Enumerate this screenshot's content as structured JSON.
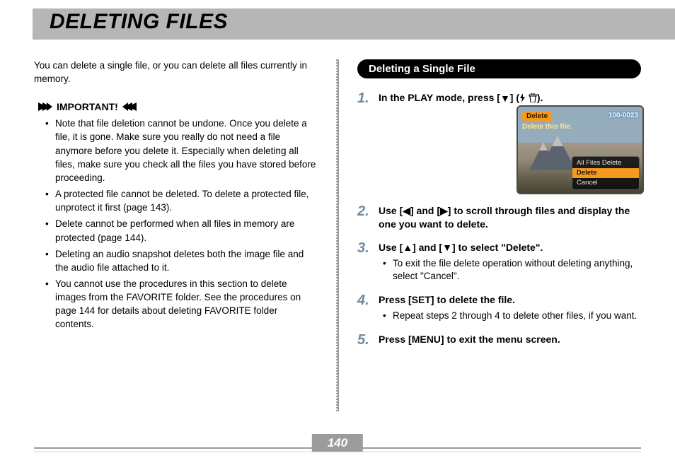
{
  "title": "DELETING FILES",
  "intro": "You can delete a single file, or you can delete all files currently in memory.",
  "important": {
    "heading": "IMPORTANT!",
    "items": [
      "Note that file deletion cannot be undone. Once you delete a file, it is gone. Make sure you really do not need a file anymore before you delete it. Especially when deleting all files, make sure you check all the files you have stored before proceeding.",
      "A protected file cannot be deleted. To delete a protected file, unprotect it first (page 143).",
      "Delete cannot be performed when all files in memory are protected (page 144).",
      "Deleting an audio snapshot deletes both the image file and the audio file attached to it.",
      "You cannot use the procedures in this section to delete images from the FAVORITE folder. See the procedures on page 144 for details about deleting FAVORITE folder contents."
    ]
  },
  "section": {
    "heading": "Deleting a Single File",
    "steps": [
      {
        "n": "1.",
        "body": "In the PLAY mode, press [▼] ({flash} {trash})."
      },
      {
        "n": "2.",
        "body": "Use [◀] and [▶] to scroll through files and display the one you want to delete."
      },
      {
        "n": "3.",
        "body": "Use [▲] and [▼] to select \"Delete\".",
        "sub": "To exit the file delete operation without deleting anything, select \"Cancel\"."
      },
      {
        "n": "4.",
        "body": "Press [SET] to delete the file.",
        "sub": "Repeat steps 2 through 4 to delete other files, if you want."
      },
      {
        "n": "5.",
        "body": "Press [MENU] to exit the menu screen."
      }
    ]
  },
  "screenshot": {
    "badge": "Delete",
    "prompt": "Delete this file.",
    "counter": "100-0023",
    "menu": [
      "All Files Delete",
      "Delete",
      "Cancel"
    ],
    "selectedIndex": 1
  },
  "pageNumber": "140"
}
